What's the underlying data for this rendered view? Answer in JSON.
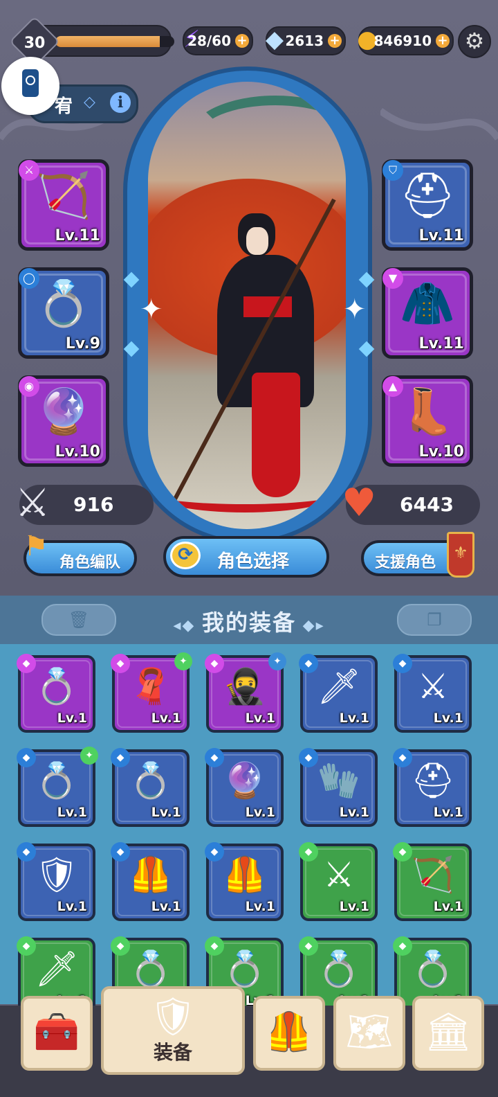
{
  "player": {
    "level": "30",
    "xp_fraction": 0.88
  },
  "resources": [
    {
      "name": "energy",
      "icon": "lightning-icon",
      "value": "28/60",
      "color": "#9a5bff"
    },
    {
      "name": "gems",
      "icon": "diamond-icon",
      "value": "2613",
      "color": "#bde1ff"
    },
    {
      "name": "gold",
      "icon": "coin-icon",
      "value": "846910",
      "color": "#f2b228"
    }
  ],
  "character_tab": {
    "name": "宥"
  },
  "equipped_left": [
    {
      "slot": "weapon",
      "item": "bow",
      "level": "Lv.11",
      "rarity": "purple"
    },
    {
      "slot": "ring",
      "item": "leaf-ring",
      "level": "Lv.9",
      "rarity": "blue"
    },
    {
      "slot": "pendant",
      "item": "purple-pendant",
      "level": "Lv.10",
      "rarity": "purple"
    }
  ],
  "equipped_right": [
    {
      "slot": "helmet",
      "item": "helmet",
      "level": "Lv.11",
      "rarity": "blue"
    },
    {
      "slot": "armor",
      "item": "green-cape",
      "level": "Lv.11",
      "rarity": "purple"
    },
    {
      "slot": "boots",
      "item": "green-boots",
      "level": "Lv.10",
      "rarity": "purple"
    }
  ],
  "stats": {
    "attack": "916",
    "hp": "6443"
  },
  "buttons": {
    "team": "角色编队",
    "select": "角色选择",
    "support": "支援角色"
  },
  "inventory": {
    "title": "我的装备",
    "items": [
      {
        "item": "ring",
        "rarity": "purple",
        "level": "Lv.1",
        "badge": ""
      },
      {
        "item": "red-scarf",
        "rarity": "purple",
        "level": "Lv.1",
        "badge": "green"
      },
      {
        "item": "dark-hood",
        "rarity": "purple",
        "level": "Lv.1",
        "badge": "blue"
      },
      {
        "item": "dagger",
        "rarity": "blue",
        "level": "Lv.1",
        "badge": ""
      },
      {
        "item": "sword",
        "rarity": "blue",
        "level": "Lv.1",
        "badge": ""
      },
      {
        "item": "gold-ring",
        "rarity": "blue",
        "level": "Lv.1",
        "badge": "green"
      },
      {
        "item": "leaf-ring",
        "rarity": "blue",
        "level": "Lv.1",
        "badge": ""
      },
      {
        "item": "purple-pendant",
        "rarity": "blue",
        "level": "Lv.1",
        "badge": ""
      },
      {
        "item": "bracer",
        "rarity": "blue",
        "level": "Lv.1",
        "badge": ""
      },
      {
        "item": "helmet",
        "rarity": "blue",
        "level": "Lv.1",
        "badge": ""
      },
      {
        "item": "gold-armor",
        "rarity": "blue",
        "level": "Lv.1",
        "badge": ""
      },
      {
        "item": "purple-armor",
        "rarity": "blue",
        "level": "Lv.1",
        "badge": ""
      },
      {
        "item": "purple-armor",
        "rarity": "blue",
        "level": "Lv.1",
        "badge": ""
      },
      {
        "item": "sword",
        "rarity": "green",
        "level": "Lv.1",
        "badge": ""
      },
      {
        "item": "bow",
        "rarity": "green",
        "level": "Lv.1",
        "badge": ""
      },
      {
        "item": "dagger",
        "rarity": "green",
        "level": "Lv.1",
        "badge": ""
      },
      {
        "item": "gold-ring",
        "rarity": "green",
        "level": "Lv.1",
        "badge": ""
      },
      {
        "item": "gold-ring",
        "rarity": "green",
        "level": "Lv.1",
        "badge": ""
      },
      {
        "item": "leaf-ring",
        "rarity": "green",
        "level": "Lv.1",
        "badge": ""
      },
      {
        "item": "leaf-ring",
        "rarity": "green",
        "level": "Lv.1",
        "badge": ""
      }
    ]
  },
  "nav": [
    {
      "name": "shop",
      "icon": "treasure-chest-icon",
      "label": ""
    },
    {
      "name": "equipment",
      "icon": "sword-shield-icon",
      "label": "装备"
    },
    {
      "name": "character",
      "icon": "armor-icon",
      "label": ""
    },
    {
      "name": "map",
      "icon": "map-icon",
      "label": ""
    },
    {
      "name": "hall",
      "icon": "temple-icon",
      "label": ""
    }
  ]
}
